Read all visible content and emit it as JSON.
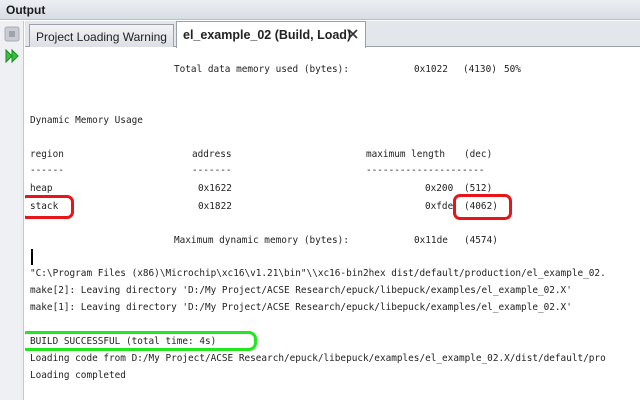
{
  "window": {
    "title": "Output"
  },
  "tabs": [
    {
      "label": "Project Loading Warning"
    },
    {
      "label": "el_example_02 (Build, Load)"
    }
  ],
  "toolbar": {
    "stop_icon": "stop-icon",
    "rerun_icon": "rerun-icon"
  },
  "console": {
    "total_data": {
      "label": "Total data memory used (bytes):",
      "hex": "0x1022",
      "dec": "(4130)",
      "pct": "50%"
    },
    "dynamic_heading": "Dynamic Memory Usage",
    "table_header": {
      "region": "region",
      "address": "address",
      "maxlen": "maximum length",
      "dec": "(dec)"
    },
    "table_rule": {
      "region": "------",
      "address": "-------",
      "maxlen": "---------------------"
    },
    "rows": [
      {
        "region": "heap",
        "address": "0x1622",
        "maxlen": "0x200",
        "dec": "(512)"
      },
      {
        "region": "stack",
        "address": "0x1822",
        "maxlen": "0xfde",
        "dec": "(4062)"
      }
    ],
    "max_dynamic": {
      "label": "Maximum dynamic memory (bytes):",
      "hex": "0x11de",
      "dec": "(4574)"
    },
    "bin2hex": "\"C:\\Program Files (x86)\\Microchip\\xc16\\v1.21\\bin\"\\\\xc16-bin2hex dist/default/production/el_example_02.",
    "make2": "make[2]: Leaving directory 'D:/My Project/ACSE Research/epuck/libepuck/examples/el_example_02.X'",
    "make1": "make[1]: Leaving directory 'D:/My Project/ACSE Research/epuck/libepuck/examples/el_example_02.X'",
    "build_status": "BUILD SUCCESSFUL (total time: 4s)",
    "loading_code": "Loading code from D:/My Project/ACSE Research/epuck/libepuck/examples/el_example_02.X/dist/default/pro",
    "loading_done": "Loading completed"
  },
  "colors": {
    "highlight_red": "#e8141a",
    "highlight_green": "#22e61e"
  }
}
